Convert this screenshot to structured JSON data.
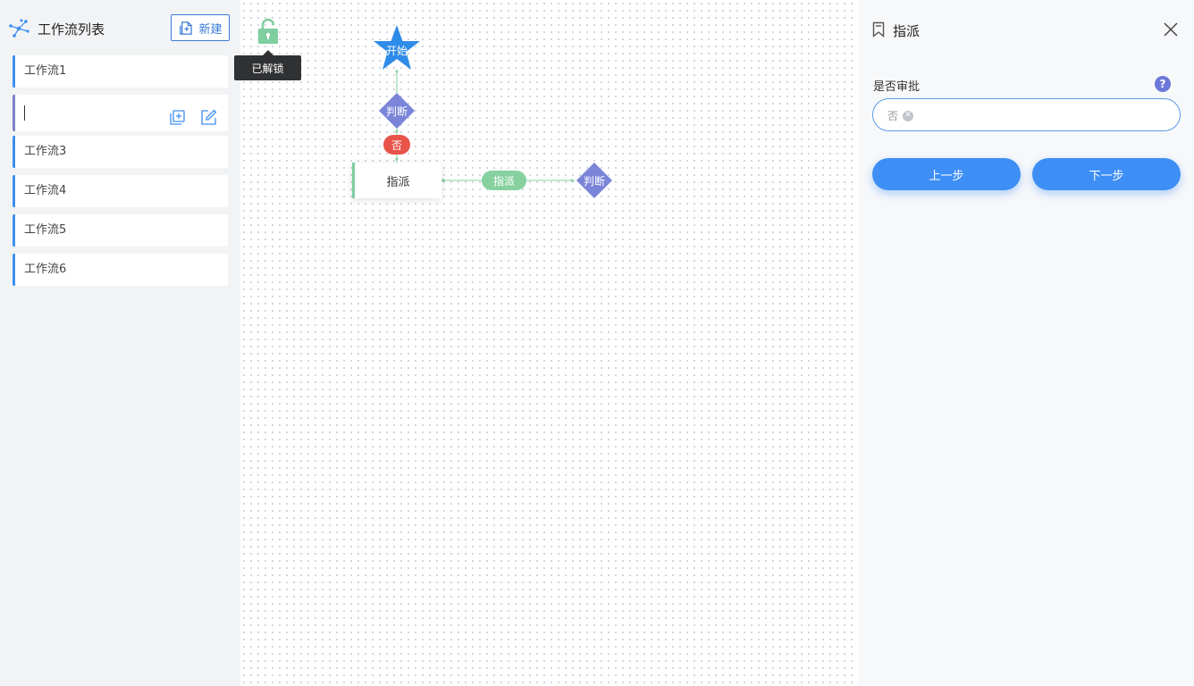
{
  "sidebar": {
    "title": "工作流列表",
    "new_label": "新建",
    "items": [
      {
        "label": "工作流1"
      },
      {
        "label": ""
      },
      {
        "label": "工作流3"
      },
      {
        "label": "工作流4"
      },
      {
        "label": "工作流5"
      },
      {
        "label": "工作流6"
      }
    ]
  },
  "canvas": {
    "lock_tooltip": "已解锁",
    "nodes": {
      "start": "开始",
      "decision1": "判断",
      "assign": "指派",
      "decision2": "判断"
    },
    "edges": {
      "no": "否",
      "assign": "指派"
    }
  },
  "panel": {
    "title": "指派",
    "field_label": "是否审批",
    "help": "?",
    "selected_value": "否",
    "prev_label": "上一步",
    "next_label": "下一步"
  },
  "colors": {
    "primary": "#3e8ff5",
    "start_node": "#2f8be8",
    "decision_node": "#7a84d8",
    "edge_no": "#e8534a",
    "edge_assign": "#86d19f",
    "lock": "#7fcea0"
  }
}
